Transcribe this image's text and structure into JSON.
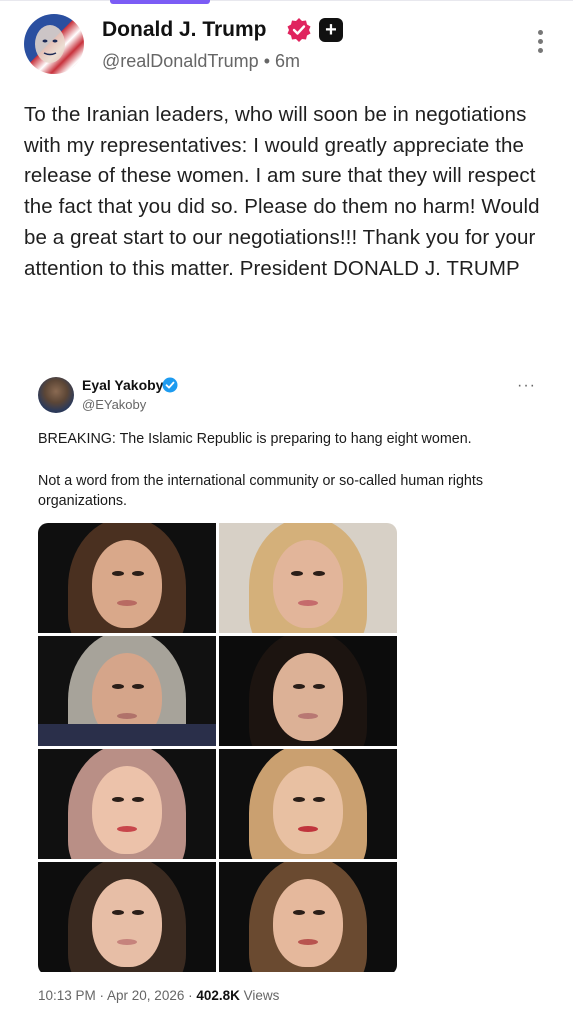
{
  "post": {
    "author_name": "Donald J. Trump",
    "handle": "@realDonaldTrump",
    "separator": "•",
    "time_ago": "6m",
    "plus_badge": "+",
    "text": "To the Iranian leaders, who will soon be in negotiations with my representatives: I would greatly appreciate the release of these women. I am sure that they will respect the fact that you did so. Please do them no harm! Would be a great start to our negotiations!!! Thank you for your attention to this matter. President DONALD J. TRUMP"
  },
  "quoted": {
    "name": "Eyal Yakoby",
    "handle": "@EYakoby",
    "dots": "···",
    "paragraph_1": "BREAKING: The Islamic Republic is preparing to hang eight women.",
    "paragraph_2": "Not a word from the international community or so-called human rights organizations.",
    "meta_time": "10:13 PM · Apr 20, 2026 · ",
    "meta_views_count": "402.8K",
    "meta_views_label": " Views"
  },
  "colors": {
    "accent": "#7b5cf5",
    "verified_pink": "#e0245e",
    "verified_blue": "#1d9bf0"
  },
  "icons": [
    "verified-badge-icon",
    "plus-icon",
    "more-vertical-icon",
    "more-horizontal-icon"
  ]
}
